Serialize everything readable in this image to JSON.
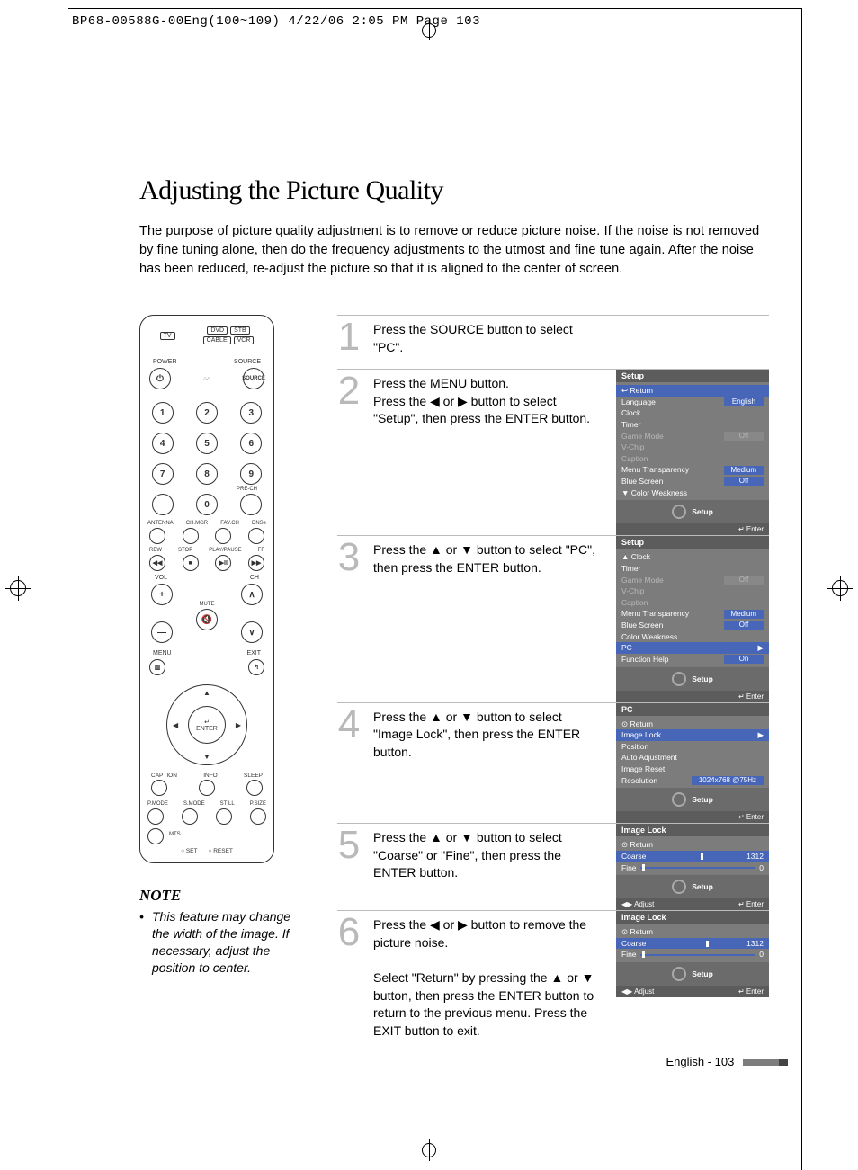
{
  "header_slug": "BP68-00588G-00Eng(100~109)  4/22/06  2:05 PM  Page 103",
  "title": "Adjusting the Picture Quality",
  "intro": "The purpose of picture quality adjustment is to remove or reduce picture noise. If the noise is not removed by fine tuning alone, then do the frequency adjustments to the utmost and fine tune again. After the noise has been reduced, re-adjust the picture so that it is aligned to the center of screen.",
  "note_heading": "NOTE",
  "note_body": "This feature may change the width of the image. If necessary, adjust the position to center.",
  "steps": [
    {
      "n": "1",
      "text": "Press the SOURCE button to select \"PC\"."
    },
    {
      "n": "2",
      "text": "Press the MENU button.\nPress the ◀ or ▶ button to select \"Setup\", then press the ENTER button."
    },
    {
      "n": "3",
      "text": "Press the ▲ or ▼ button to select \"PC\", then press the ENTER button."
    },
    {
      "n": "4",
      "text": "Press the ▲ or ▼ button to select \"Image Lock\", then press the ENTER button."
    },
    {
      "n": "5",
      "text": "Press the ▲ or ▼ button to select \"Coarse\" or \"Fine\", then press the ENTER button."
    },
    {
      "n": "6",
      "text": "Press the ◀ or ▶ button to remove the picture noise.\n\nSelect \"Return\" by pressing the ▲ or ▼ button, then press the ENTER button to return to the previous menu. Press the EXIT button to exit."
    }
  ],
  "osd2": {
    "title": "Setup",
    "return": "↩ Return",
    "rows": [
      {
        "label": "Language",
        "value": "English"
      },
      {
        "label": "Clock"
      },
      {
        "label": "Timer"
      },
      {
        "label": "Game Mode",
        "value": "Off",
        "dim": true
      },
      {
        "label": "V-Chip",
        "dim": true
      },
      {
        "label": "Caption",
        "dim": true
      },
      {
        "label": "Menu Transparency",
        "value": "Medium"
      },
      {
        "label": "Blue Screen",
        "value": "Off"
      },
      {
        "label": "▼ Color Weakness"
      }
    ],
    "foot": "Setup",
    "bar_right": "↵ Enter"
  },
  "osd3": {
    "title": "Setup",
    "rows": [
      {
        "label": "▲ Clock"
      },
      {
        "label": "Timer"
      },
      {
        "label": "Game Mode",
        "value": "Off",
        "dim": true
      },
      {
        "label": "V-Chip",
        "dim": true
      },
      {
        "label": "Caption",
        "dim": true
      },
      {
        "label": "Menu Transparency",
        "value": "Medium"
      },
      {
        "label": "Blue Screen",
        "value": "Off"
      },
      {
        "label": "Color Weakness"
      },
      {
        "label": "PC",
        "hi": true,
        "arrow": "▶"
      },
      {
        "label": "Function Help",
        "value": "On"
      }
    ],
    "foot": "Setup",
    "bar_right": "↵ Enter"
  },
  "osd4": {
    "title": "PC",
    "return": "⊙ Return",
    "rows": [
      {
        "label": "Image Lock",
        "hi": true,
        "arrow": "▶"
      },
      {
        "label": "Position"
      },
      {
        "label": "Auto Adjustment"
      },
      {
        "label": "Image Reset"
      },
      {
        "label": "Resolution",
        "value": "1024x768 @75Hz"
      }
    ],
    "foot": "Setup",
    "bar_right": "↵ Enter"
  },
  "osd5": {
    "title": "Image Lock",
    "return": "⊙ Return",
    "coarse_label": "Coarse",
    "coarse_val": "1312",
    "fine_label": "Fine",
    "fine_val": "0",
    "foot": "Setup",
    "bar_left": "◀▶ Adjust",
    "bar_right": "↵ Enter"
  },
  "osd6": {
    "title": "Image Lock",
    "return": "⊙ Return",
    "coarse_label": "Coarse",
    "coarse_val": "1312",
    "fine_label": "Fine",
    "fine_val": "0",
    "foot": "Setup",
    "bar_left": "◀▶ Adjust",
    "bar_right": "↵ Enter"
  },
  "remote": {
    "top": [
      "TV",
      "DVD",
      "STB",
      "CABLE",
      "VCR"
    ],
    "power": "POWER",
    "source": "SOURCE",
    "digits": [
      "1",
      "2",
      "3",
      "4",
      "5",
      "6",
      "7",
      "8",
      "9",
      "0"
    ],
    "dash": "—",
    "prech": "PRE-CH",
    "row_labels": [
      "ANTENNA",
      "CH.MGR",
      "FAV.CH",
      "DNSe"
    ],
    "transport": [
      "REW",
      "STOP",
      "PLAY/PAUSE",
      "FF"
    ],
    "vol": "VOL",
    "ch": "CH",
    "mute": "MUTE",
    "menu": "MENU",
    "exit": "EXIT",
    "enter": "ENTER",
    "bottom1": [
      "CAPTION",
      "INFO",
      "SLEEP"
    ],
    "bottom2": [
      "P.MODE",
      "S.MODE",
      "STILL",
      "P.SIZE"
    ],
    "mts": "MTS",
    "set": "○ SET",
    "reset": "○ RESET"
  },
  "footer": "English - 103"
}
